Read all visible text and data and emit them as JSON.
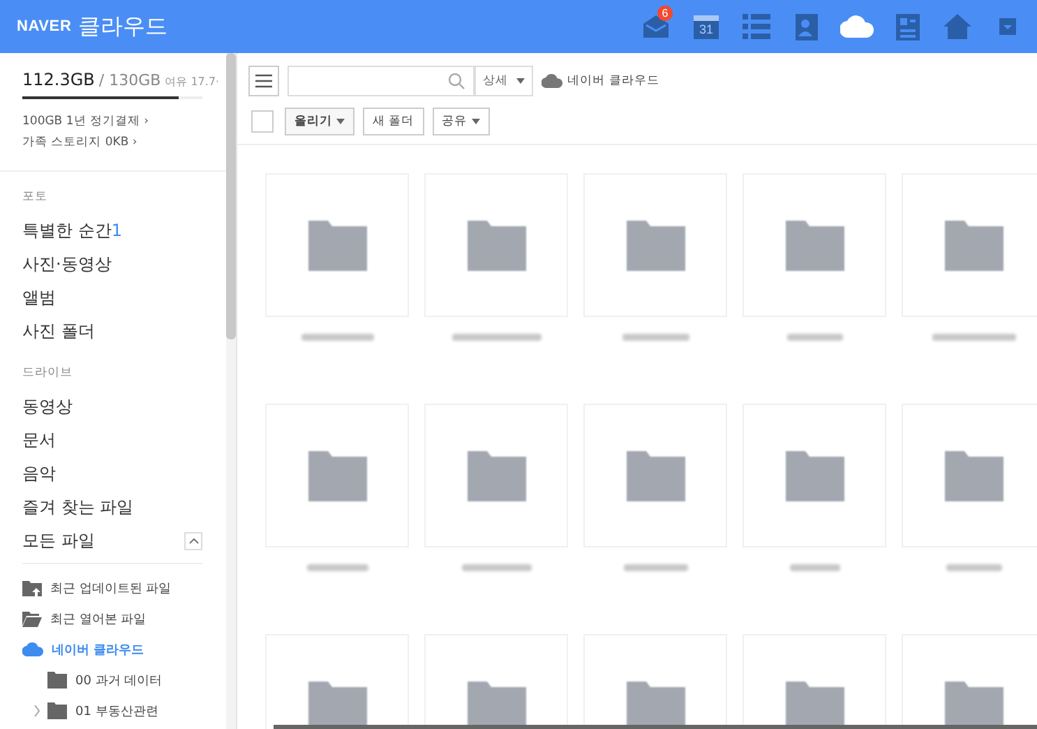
{
  "header": {
    "logo": "NAVER",
    "title": "클라우드",
    "apps": [
      {
        "kind": "mail",
        "badge": "6",
        "selected": false
      },
      {
        "kind": "calendar",
        "label": "31",
        "selected": false
      },
      {
        "kind": "list",
        "selected": false
      },
      {
        "kind": "contacts",
        "selected": false
      },
      {
        "kind": "cloud",
        "selected": true
      },
      {
        "kind": "memo",
        "selected": false
      },
      {
        "kind": "home",
        "selected": false
      },
      {
        "kind": "more",
        "selected": false
      }
    ]
  },
  "storage": {
    "used": "112.3GB",
    "total": "/ 130GB",
    "free": "여유 17.7·",
    "level": 0.87,
    "links": [
      "100GB 1년 정기결제 ›",
      "가족 스토리지 0KB ›"
    ]
  },
  "sections": [
    {
      "title": "포토",
      "items": [
        {
          "label": "특별한 순간",
          "count": "1"
        },
        {
          "label": "사진·동영상"
        },
        {
          "label": "앨범"
        },
        {
          "label": "사진 폴더"
        }
      ]
    },
    {
      "title": "드라이브",
      "items": [
        {
          "label": "동영상"
        },
        {
          "label": "문서"
        },
        {
          "label": "음악"
        },
        {
          "label": "즐겨 찾는 파일"
        },
        {
          "label": "모든 파일",
          "expanded": true
        }
      ]
    }
  ],
  "tree": [
    {
      "kind": "recent-updated",
      "label": "최근 업데이트된 파일",
      "selected": false
    },
    {
      "kind": "recent-opened",
      "label": "최근 열어본 파일",
      "selected": false
    },
    {
      "kind": "cloud",
      "label": "네이버 클라우드",
      "selected": true,
      "children": [
        {
          "kind": "folder",
          "label": "00 과거 데이터"
        },
        {
          "kind": "folder",
          "label": "01 부동산관련",
          "expanded": false
        }
      ]
    }
  ],
  "toolbar": {
    "detail": "상세",
    "location": "네이버 클라우드",
    "select_all": {
      "checked": false
    },
    "buttons": [
      {
        "label": "올리기",
        "dropdown": true
      },
      {
        "label": "새 폴더",
        "dropdown": false
      },
      {
        "label": "공유",
        "dropdown": true
      }
    ]
  },
  "files": [
    {
      "kind": "folder"
    },
    {
      "kind": "folder"
    },
    {
      "kind": "folder"
    },
    {
      "kind": "folder"
    },
    {
      "kind": "folder"
    },
    {
      "kind": "folder"
    },
    {
      "kind": "folder"
    },
    {
      "kind": "folder"
    },
    {
      "kind": "folder"
    },
    {
      "kind": "folder"
    },
    {
      "kind": "folder"
    },
    {
      "kind": "folder"
    },
    {
      "kind": "folder"
    },
    {
      "kind": "folder"
    },
    {
      "kind": "folder"
    }
  ]
}
